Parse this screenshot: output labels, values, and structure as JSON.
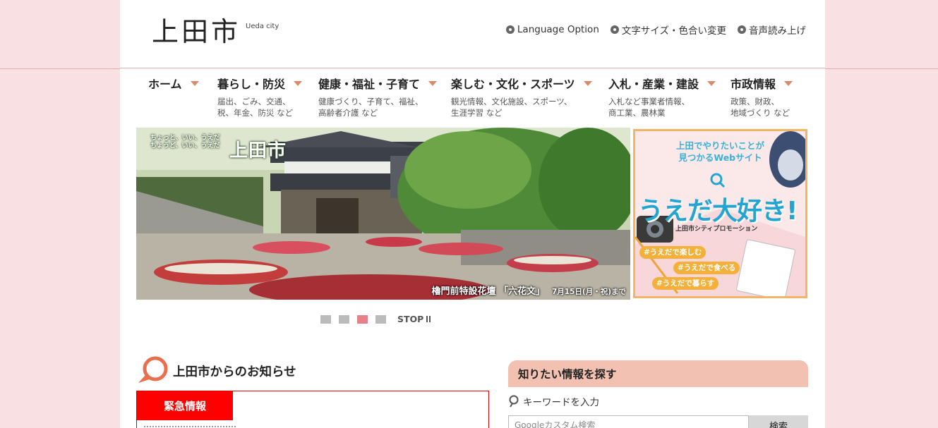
{
  "header": {
    "logo_title": "上田市",
    "logo_sub": "Ueda city",
    "util_links": [
      "Language Option",
      "文字サイズ・色合い変更",
      "音声読み上げ"
    ]
  },
  "nav": [
    {
      "label": "ホーム",
      "desc1": "",
      "desc2": ""
    },
    {
      "label": "暮らし・防災",
      "desc1": "届出、ごみ、交通、",
      "desc2": "税、年金、防災 など"
    },
    {
      "label": "健康・福祉・子育て",
      "desc1": "健康づくり、子育て、福祉、",
      "desc2": "高齢者介護 など"
    },
    {
      "label": "楽しむ・文化・スポーツ",
      "desc1": "観光情報、文化施設、スポーツ、",
      "desc2": "生涯学習 など"
    },
    {
      "label": "入札・産業・建設",
      "desc1": "入札など事業者情報、",
      "desc2": "商工業、農林業"
    },
    {
      "label": "市政情報",
      "desc1": "政策、財政、",
      "desc2": "地域づくり など"
    }
  ],
  "hero": {
    "logo_small_1": "ちょっと、いい、うえだ",
    "logo_small_2": "ちょうど、いい、うえだ",
    "logo_big": "上田市",
    "caption": "櫓門前特設花壇 「六花文」",
    "caption_date": "7月15日(月・祝)まで"
  },
  "promo": {
    "line1": "上田でやりたいことが",
    "line2": "見つかるWebサイト",
    "big": "うえだ大好き!",
    "sub": "上田市シティプロモーション",
    "tags": [
      "#うえだで楽しむ",
      "#うえだで食べる",
      "#うえだで暮らす"
    ]
  },
  "slider": {
    "active_index": 2,
    "stop_label": "STOP"
  },
  "news": {
    "title": "上田市からのお知らせ",
    "emergency_tab": "緊急情報"
  },
  "search": {
    "title": "知りたい情報を探す",
    "label": "キーワードを入力",
    "placeholder": "Googleカスタム検索",
    "button": "検索"
  },
  "colors": {
    "background": "#f9e1e3",
    "nav_arrow": "#d98a6b",
    "emergency": "#ff0000",
    "search_header": "#f3c1b2",
    "slider_active": "#e8808c",
    "promo_border": "#f3b563"
  }
}
